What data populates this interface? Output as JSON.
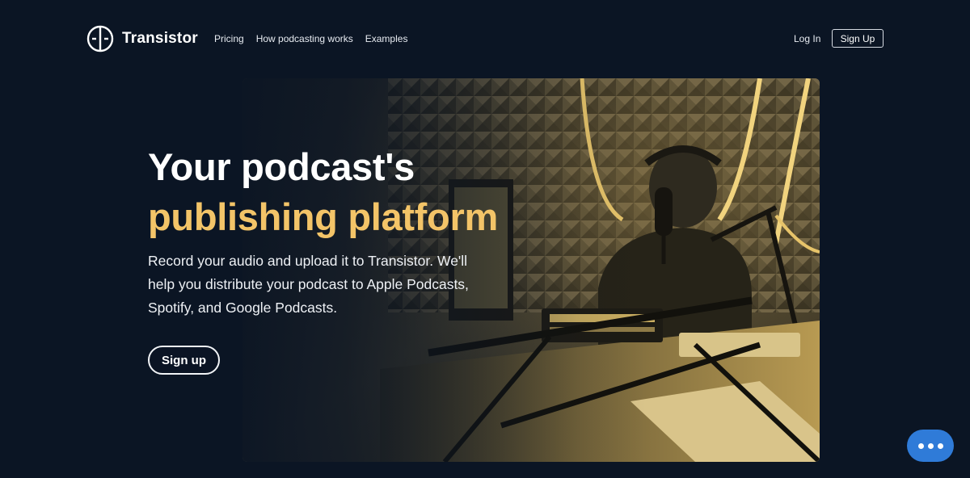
{
  "brand": {
    "name": "Transistor",
    "logo_icon": "transistor-logo-icon"
  },
  "nav": {
    "links": [
      "Pricing",
      "How podcasting works",
      "Examples"
    ],
    "login_label": "Log In",
    "signup_label": "Sign Up"
  },
  "hero": {
    "title_line1": "Your podcast's",
    "title_line2": "publishing platform",
    "description": "Record your audio and upload it to Transistor. We'll help you distribute your podcast to Apple Podcasts, Spotify, and Google Podcasts.",
    "cta_label": "Sign up"
  },
  "chat": {
    "icon": "chat-dots-icon"
  },
  "colors": {
    "background": "#0b1524",
    "accent_gold": "#f3c468",
    "chat_blue": "#2f7bd8"
  }
}
